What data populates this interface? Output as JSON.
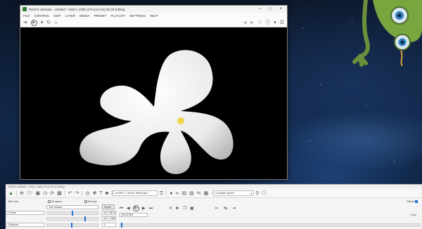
{
  "app": {
    "title": "RiseFX Ultimate - Untitled * 1920 x 1080 (47%) [AA16] 30.00 Editing",
    "menu": [
      "FILE",
      "CONTROL",
      "EDIT",
      "LAYER",
      "MEDIA",
      "PRESET",
      "PLAYLIST",
      "SETTINGS",
      "HELP"
    ]
  },
  "panel": {
    "title": "RiseFX Ultimate * 1920 x 1080 (47%) 30.00 Editing",
    "layer_label": "LAYER 1: Vector \"Blob.wpa\"",
    "speed_label": "Constant speed",
    "preset_label": "Text rotation",
    "reset_label": "Reset",
    "position_label": "Web size",
    "all_layers_label": "All layers",
    "all_keys_label": "All keys",
    "x_value": "54.1 88 %",
    "y_value": "32.1 1389",
    "time_value": "00:00.000",
    "frame_value": "0",
    "left_select_1": "Centre",
    "left_select_2": "Softened",
    "visible_label": "Visible",
    "key_label": "1 key"
  },
  "icons": {
    "toolbar": [
      "back-icon",
      "play-icon",
      "refresh-icon",
      "home-icon",
      "undo-icon",
      "help-icon",
      "menu-icon"
    ],
    "accent": "#1f6fd6"
  }
}
